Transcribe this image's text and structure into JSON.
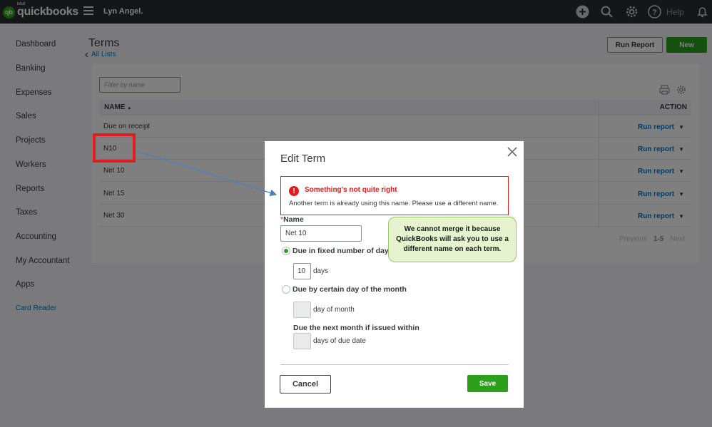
{
  "app": {
    "logo_mark": "qb",
    "logo_brand": "intuit",
    "logo_text": "quickbooks",
    "company_name": "Lyn Angel.",
    "help_label": "Help",
    "icons": [
      "plus-icon",
      "search-icon",
      "gear-icon",
      "help-icon",
      "bell-icon"
    ]
  },
  "sidebar": {
    "items": [
      {
        "label": "Dashboard"
      },
      {
        "label": "Banking"
      },
      {
        "label": "Expenses"
      },
      {
        "label": "Sales"
      },
      {
        "label": "Projects"
      },
      {
        "label": "Workers"
      },
      {
        "label": "Reports"
      },
      {
        "label": "Taxes"
      },
      {
        "label": "Accounting"
      },
      {
        "label": "My Accountant"
      },
      {
        "label": "Apps"
      }
    ],
    "card_reader": "Card Reader"
  },
  "page": {
    "title": "Terms",
    "back_link": "All Lists",
    "run_report_button": "Run Report",
    "new_button": "New"
  },
  "table": {
    "filter_placeholder": "Filter by name",
    "col_name": "NAME",
    "sort_indicator": "▲",
    "col_action": "ACTION",
    "rows": [
      {
        "name": "Due on receipt",
        "action": "Run report"
      },
      {
        "name": "N10",
        "action": "Run report"
      },
      {
        "name": "Net 10",
        "action": "Run report"
      },
      {
        "name": "Net 15",
        "action": "Run report"
      },
      {
        "name": "Net 30",
        "action": "Run report"
      }
    ],
    "pager": {
      "previous": "Previous",
      "range": "1-5",
      "next": "Next"
    }
  },
  "modal": {
    "title": "Edit Term",
    "error": {
      "title": "Something's not quite right",
      "message": "Another term is already using this name. Please use a different name."
    },
    "name_required_mark": "*",
    "name_label": "Name",
    "name_value": "Net 10",
    "option_fixed": {
      "label": "Due in fixed number of days",
      "selected": true,
      "days_value": "10",
      "days_unit": "days"
    },
    "option_day_of_month": {
      "label": "Due by certain day of the month",
      "selected": false,
      "day_unit": "day of month",
      "next_month_label": "Due the next month if issued within",
      "due_date_unit": "days of due date"
    },
    "cancel_button": "Cancel",
    "save_button": "Save"
  },
  "annotation": {
    "callout_text": "We cannot merge it because QuickBooks will ask you to use a different name on each term.",
    "highlight_color": "#e21d1d",
    "arrow_color": "#4a7fc1"
  },
  "colors": {
    "brand_green": "#2ca01c",
    "link_blue": "#0077c5",
    "error_red": "#e21d1d",
    "topbar": "#2b2c2e"
  }
}
